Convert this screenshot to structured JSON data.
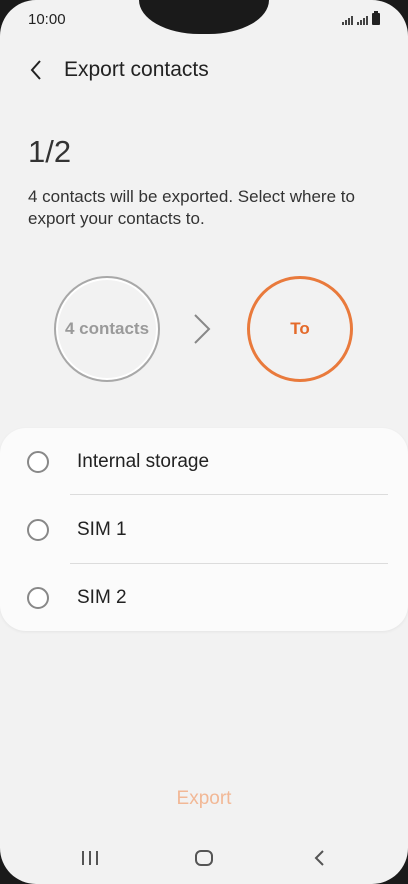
{
  "status_bar": {
    "time": "10:00",
    "icons": [
      "signal-icon",
      "signal-icon",
      "battery-icon"
    ]
  },
  "header": {
    "back_icon": "chevron-left-icon",
    "title": "Export contacts"
  },
  "step": {
    "label": "1/2"
  },
  "description": "4 contacts will be exported. Select where to export your contacts to.",
  "flow": {
    "source_label": "4 contacts",
    "arrow_icon": "chevron-right-icon",
    "target_label": "To"
  },
  "options": [
    {
      "label": "Internal storage",
      "selected": false
    },
    {
      "label": "SIM 1",
      "selected": false
    },
    {
      "label": "SIM 2",
      "selected": false
    }
  ],
  "export_button": {
    "label": "Export",
    "enabled": false
  },
  "nav_bar": {
    "icons": [
      "recent-apps-icon",
      "home-icon",
      "back-icon"
    ]
  },
  "colors": {
    "accent": "#e97a3c",
    "disabled_accent": "#f2b896",
    "background": "#f2f2f2"
  }
}
